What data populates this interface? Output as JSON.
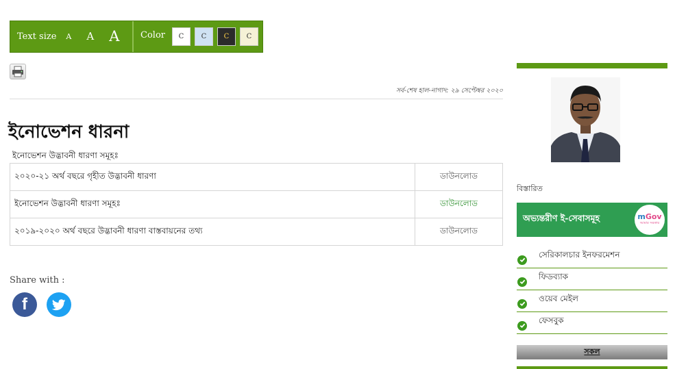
{
  "toolbar": {
    "text_size_label": "Text size",
    "size_small": "A",
    "size_medium": "A",
    "size_large": "A",
    "color_label": "Color",
    "swatches": [
      "C",
      "C",
      "C",
      "C"
    ],
    "swatch_colors": [
      "#ffffff",
      "#cfe2f3",
      "#2b2b2b",
      "#f5f1d6"
    ],
    "accent": "#5d9a14"
  },
  "print_icon": "printer-icon",
  "last_updated": "সর্ব-শেষ হাল-নাগাদ: ২৯ সেপ্টেম্বর ২০২০",
  "page_title": "ইনোভেশন ধারনা",
  "subtitle": "ইনোভেশন উদ্ভাবনী ধারণা সমূহঃ",
  "documents": [
    {
      "title": "২০২০-২১ অর্থ বছরে গৃহীত উদ্ভাবনী ধারণা",
      "link": "ডাউনলোড"
    },
    {
      "title": "ইনোভেশন উদ্ভাবনী ধারণা সমূহঃ",
      "link": "ডাউনলোড"
    },
    {
      "title": "২০১৯-২০২০ অর্থ বছরে উদ্ভাবনী ধারণা বাস্তবায়নের তথ্য",
      "link": "ডাউনলোড"
    }
  ],
  "share": {
    "label": "Share with :",
    "facebook_glyph": "f",
    "icons": [
      "facebook-icon",
      "twitter-icon"
    ]
  },
  "sidebar": {
    "details_link": "বিস্তারিত",
    "eservice_label": "অভ্যন্তরীণ ই-সেবাসমূহ",
    "mgov_logo_m": "m",
    "mgov_logo_gov": "Gov",
    "mgov_tagline": "আমার সরকার",
    "links": [
      "সেরিকালচার ইনফরমেশন",
      "ফিডব্যাক",
      "ওয়েব মেইল",
      "ফেসবুক"
    ],
    "all_button": "সকল"
  }
}
